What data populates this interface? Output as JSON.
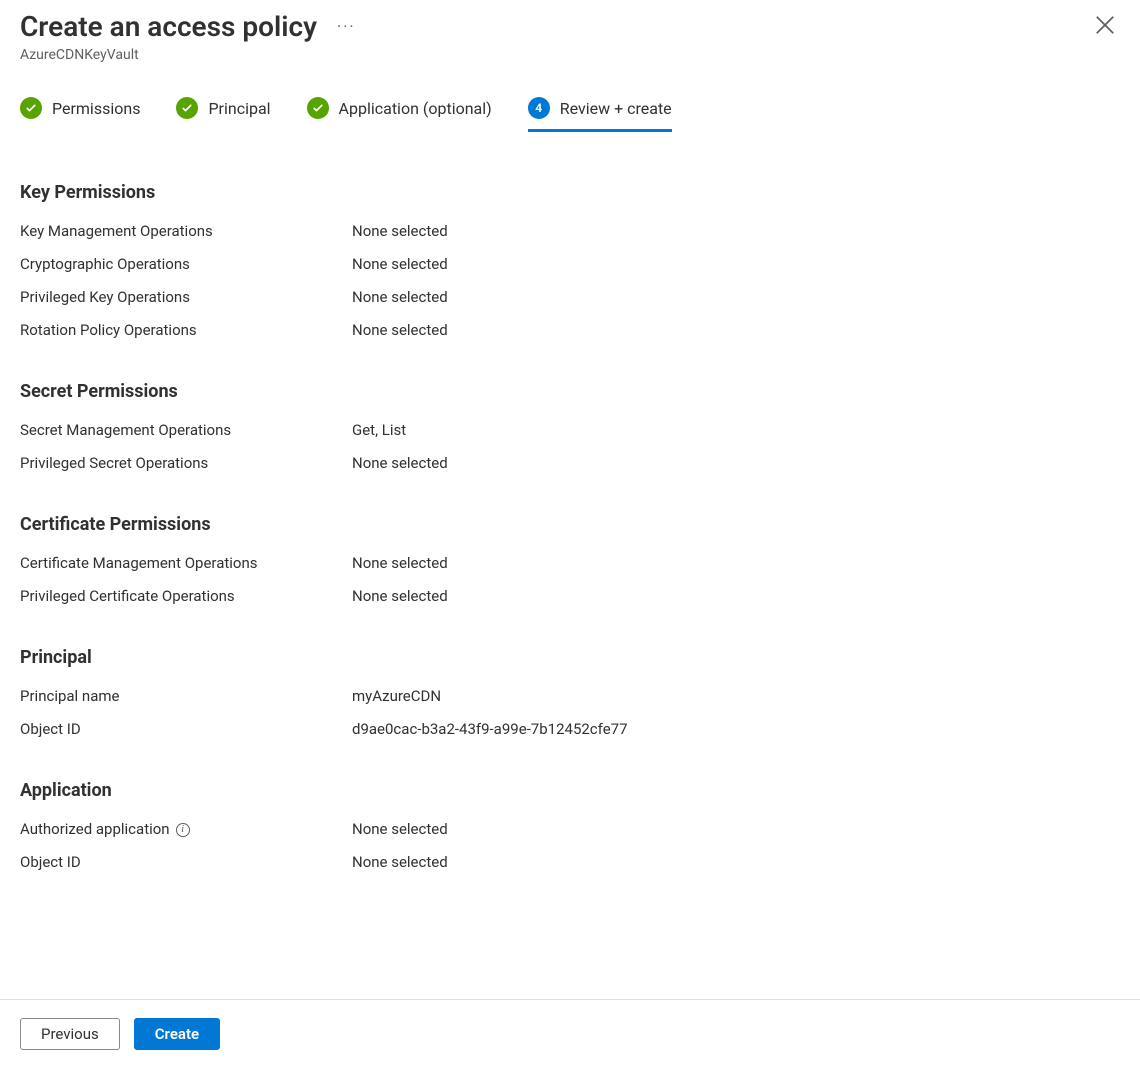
{
  "header": {
    "title": "Create an access policy",
    "subtitle": "AzureCDNKeyVault"
  },
  "tabs": [
    {
      "label": "Permissions",
      "state": "complete"
    },
    {
      "label": "Principal",
      "state": "complete"
    },
    {
      "label": "Application (optional)",
      "state": "complete"
    },
    {
      "label": "Review + create",
      "state": "current",
      "number": "4"
    }
  ],
  "sections": {
    "key_permissions": {
      "title": "Key Permissions",
      "rows": [
        {
          "label": "Key Management Operations",
          "value": "None selected"
        },
        {
          "label": "Cryptographic Operations",
          "value": "None selected"
        },
        {
          "label": "Privileged Key Operations",
          "value": "None selected"
        },
        {
          "label": "Rotation Policy Operations",
          "value": "None selected"
        }
      ]
    },
    "secret_permissions": {
      "title": "Secret Permissions",
      "rows": [
        {
          "label": "Secret Management Operations",
          "value": "Get, List"
        },
        {
          "label": "Privileged Secret Operations",
          "value": "None selected"
        }
      ]
    },
    "certificate_permissions": {
      "title": "Certificate Permissions",
      "rows": [
        {
          "label": "Certificate Management Operations",
          "value": "None selected"
        },
        {
          "label": "Privileged Certificate Operations",
          "value": "None selected"
        }
      ]
    },
    "principal": {
      "title": "Principal",
      "rows": [
        {
          "label": "Principal name",
          "value": "myAzureCDN"
        },
        {
          "label": "Object ID",
          "value": "d9ae0cac-b3a2-43f9-a99e-7b12452cfe77"
        }
      ]
    },
    "application": {
      "title": "Application",
      "rows": [
        {
          "label": "Authorized application",
          "value": "None selected",
          "info": true
        },
        {
          "label": "Object ID",
          "value": "None selected"
        }
      ]
    }
  },
  "footer": {
    "previous": "Previous",
    "create": "Create"
  }
}
